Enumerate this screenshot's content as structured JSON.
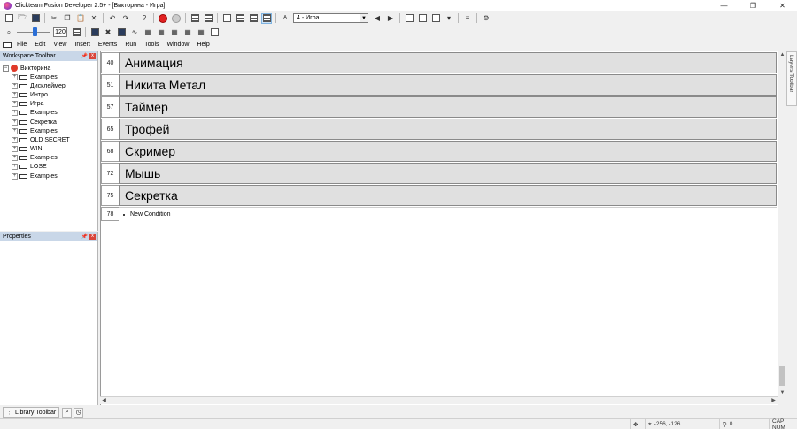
{
  "window": {
    "title": "Clickteam Fusion Developer 2.5+ - [Викторина - Игра]",
    "min": "—",
    "max": "❐",
    "close": "✕"
  },
  "toolbar2": {
    "zoom": "120",
    "frame_select": "4 - Игра"
  },
  "menu": [
    "File",
    "Edit",
    "View",
    "Insert",
    "Events",
    "Run",
    "Tools",
    "Window",
    "Help"
  ],
  "workspace": {
    "title": "Workspace Toolbar",
    "root": "Викторина",
    "items": [
      "Examples",
      "Дисклеймер",
      "Интро",
      "Игра",
      "Examples",
      "Секретка",
      "Examples",
      "OLD SECRET",
      "WIN",
      "Examples",
      "LOSE",
      "Examples"
    ]
  },
  "properties": {
    "title": "Properties"
  },
  "library": {
    "tab": "Library Toolbar"
  },
  "events": [
    {
      "num": "40",
      "label": "Анимация"
    },
    {
      "num": "51",
      "label": "Никита Метал"
    },
    {
      "num": "57",
      "label": "Таймер"
    },
    {
      "num": "65",
      "label": "Трофей"
    },
    {
      "num": "68",
      "label": "Скример"
    },
    {
      "num": "72",
      "label": "Мышь"
    },
    {
      "num": "75",
      "label": "Секретка"
    }
  ],
  "new_condition": {
    "num": "78",
    "label": "New Condition"
  },
  "layers": {
    "title": "Layers Toolbar"
  },
  "status": {
    "coords": "-256, -126",
    "objects": "0",
    "keys": "CAP NUM"
  }
}
